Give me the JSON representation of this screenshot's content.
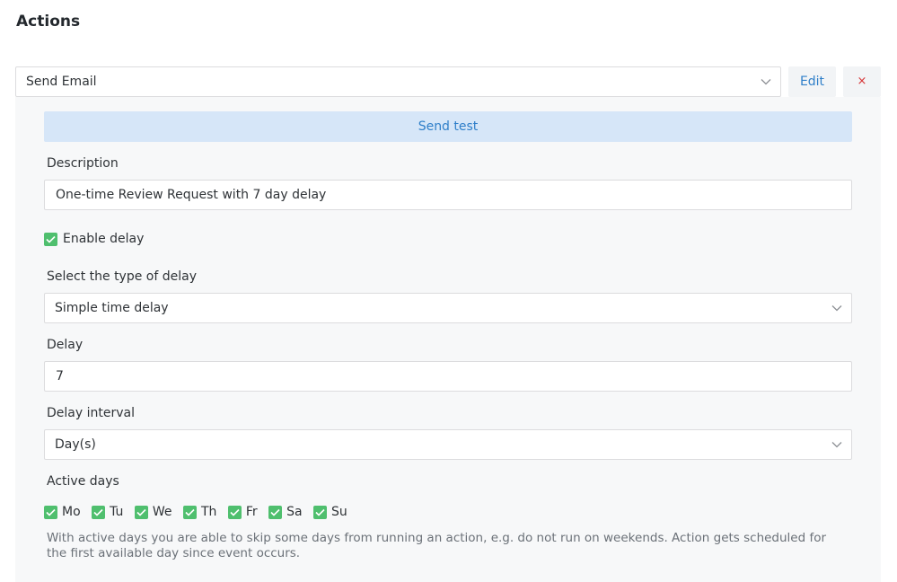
{
  "header": {
    "title": "Actions"
  },
  "action": {
    "selected": "Send Email",
    "edit_label": "Edit",
    "remove_label": "×"
  },
  "send_test_label": "Send test",
  "description": {
    "label": "Description",
    "value": "One-time Review Request with 7 day delay"
  },
  "enable_delay": {
    "label": "Enable delay",
    "checked": true
  },
  "delay_type": {
    "label": "Select the type of delay",
    "value": "Simple time delay"
  },
  "delay": {
    "label": "Delay",
    "value": "7"
  },
  "delay_interval": {
    "label": "Delay interval",
    "value": "Day(s)"
  },
  "active_days": {
    "label": "Active days",
    "days": [
      {
        "label": "Mo",
        "checked": true
      },
      {
        "label": "Tu",
        "checked": true
      },
      {
        "label": "We",
        "checked": true
      },
      {
        "label": "Th",
        "checked": true
      },
      {
        "label": "Fr",
        "checked": true
      },
      {
        "label": "Sa",
        "checked": true
      },
      {
        "label": "Su",
        "checked": true
      }
    ],
    "help": "With active days you are able to skip some days from running an action, e.g. do not run on weekends. Action gets scheduled for the first available day since event occurs."
  },
  "colors": {
    "accent": "#2f7fc9",
    "checkbox": "#4fbf6e",
    "danger": "#d63638",
    "send_test_bg": "#d6e6f8"
  }
}
